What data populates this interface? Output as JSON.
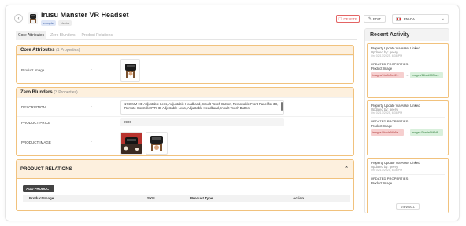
{
  "header": {
    "back_icon": "arrow-left-icon",
    "title": "Irusu Manster VR Headset",
    "tags": [
      "sample",
      "Vector"
    ],
    "delete_label": "DELETE",
    "edit_label": "EDIT",
    "language": "EN-CA"
  },
  "tabs": [
    {
      "label": "Core Attributes",
      "active": true
    },
    {
      "label": "Zero Blunders",
      "active": false
    },
    {
      "label": "Product Relations",
      "active": false
    }
  ],
  "core_attributes": {
    "title": "Core Attributes",
    "count": "(1 Properties)",
    "rows": [
      {
        "label": "Product Image",
        "dash": "-"
      }
    ]
  },
  "zero_blunders": {
    "title": "Zero Blunders",
    "count": "(3 Properties)",
    "description_label": "DESCRIPTION",
    "description_value": "1740MM HD Adjustable Lens, Adjustable Headband, Inbuilt Touch Button, Removable Front Panel for 3D, Remote ControllerIVRHD Adjustable Lens, Adjustable Headband, Inbuilt Touch Button,",
    "price_label": "PRODUCT PRICE",
    "price_value": "8900",
    "image_label": "PRODUCT IMAGE",
    "dash": "-"
  },
  "product_relations": {
    "title": "PRODUCT RELATIONS",
    "add_label": "ADD PRODUCT",
    "columns": [
      "Product Image",
      "SKU",
      "Product Type",
      "Action"
    ]
  },
  "activity": {
    "title": "Recent Activity",
    "items": [
      {
        "title": "Property Update Via Asset Linked",
        "by": "Updated by: geery",
        "date": "On: 02/17/2025, 6:36 PM",
        "updated": "UPDATED PROPERTIES:",
        "property": "Product Image",
        "old": "images/1ba9d0e4ff...",
        "new": "images/11bad0022a..."
      },
      {
        "title": "Property Update Via Asset Linked",
        "by": "Updated by: geery",
        "date": "On: 02/17/2025, 6:36 PM",
        "updated": "UPDATED PROPERTIES:",
        "property": "Product Image",
        "old": "images/3bada94b6e...",
        "new": "images/3bada94f6d8..."
      },
      {
        "title": "Property Update Via Asset Linked",
        "by": "Updated by: geery",
        "date": "On: 02/17/2025, 6:36 PM",
        "updated": "UPDATED PROPERTIES:",
        "property": "Product Image"
      }
    ],
    "see_all": "VIEW ALL"
  }
}
